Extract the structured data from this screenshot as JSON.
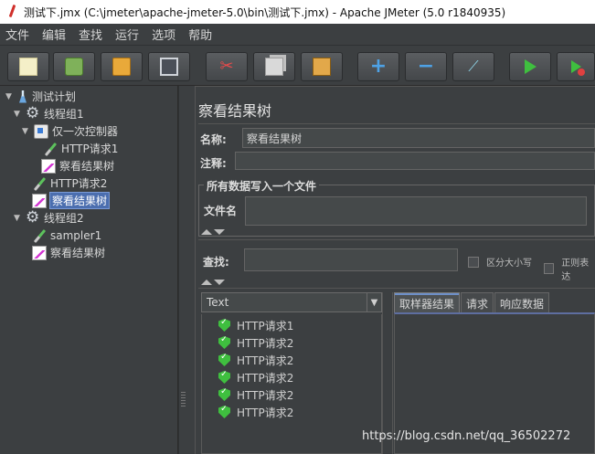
{
  "window": {
    "title": "测试下.jmx (C:\\jmeter\\apache-jmeter-5.0\\bin\\测试下.jmx) - Apache JMeter (5.0 r1840935)"
  },
  "menu": [
    "文件",
    "编辑",
    "查找",
    "运行",
    "选项",
    "帮助"
  ],
  "toolbar": {
    "icons": [
      "new-icon",
      "templates-icon",
      "open-icon",
      "save-icon",
      "cut-icon",
      "copy-icon",
      "paste-icon",
      "expand-icon",
      "collapse-icon",
      "toggle-icon",
      "start-icon",
      "start-no-pauses-icon"
    ]
  },
  "tree": [
    {
      "label": "测试计划",
      "icon": "test-plan-icon",
      "toggle": "▼"
    },
    {
      "label": "线程组1",
      "icon": "thread-group-icon",
      "toggle": "▼"
    },
    {
      "label": "仅一次控制器",
      "icon": "controller-icon",
      "toggle": "▼"
    },
    {
      "label": "HTTP请求1",
      "icon": "sampler-icon",
      "toggle": ""
    },
    {
      "label": "察看结果树",
      "icon": "listener-icon",
      "toggle": ""
    },
    {
      "label": "HTTP请求2",
      "icon": "sampler-icon",
      "toggle": ""
    },
    {
      "label": "察看结果树",
      "icon": "listener-icon",
      "toggle": "",
      "selected": true
    },
    {
      "label": "线程组2",
      "icon": "thread-group-icon",
      "toggle": "▼"
    },
    {
      "label": "sampler1",
      "icon": "sampler-icon",
      "toggle": ""
    },
    {
      "label": "察看结果树",
      "icon": "listener-icon",
      "toggle": ""
    }
  ],
  "panel": {
    "title": "察看结果树",
    "name_label": "名称:",
    "name_value": "察看结果树",
    "comment_label": "注释:",
    "comment_value": "",
    "group_title": "所有数据写入一个文件",
    "filename_label": "文件名",
    "filename_value": "",
    "search_label": "查找:",
    "search_value": "",
    "case_sensitive_label": "区分大小写",
    "regex_label": "正则表达"
  },
  "renderer": {
    "selected": "Text"
  },
  "results": [
    "HTTP请求1",
    "HTTP请求2",
    "HTTP请求2",
    "HTTP请求2",
    "HTTP请求2",
    "HTTP请求2"
  ],
  "tabs": [
    "取样器结果",
    "请求",
    "响应数据"
  ],
  "watermark": "https://blog.csdn.net/qq_36502272"
}
